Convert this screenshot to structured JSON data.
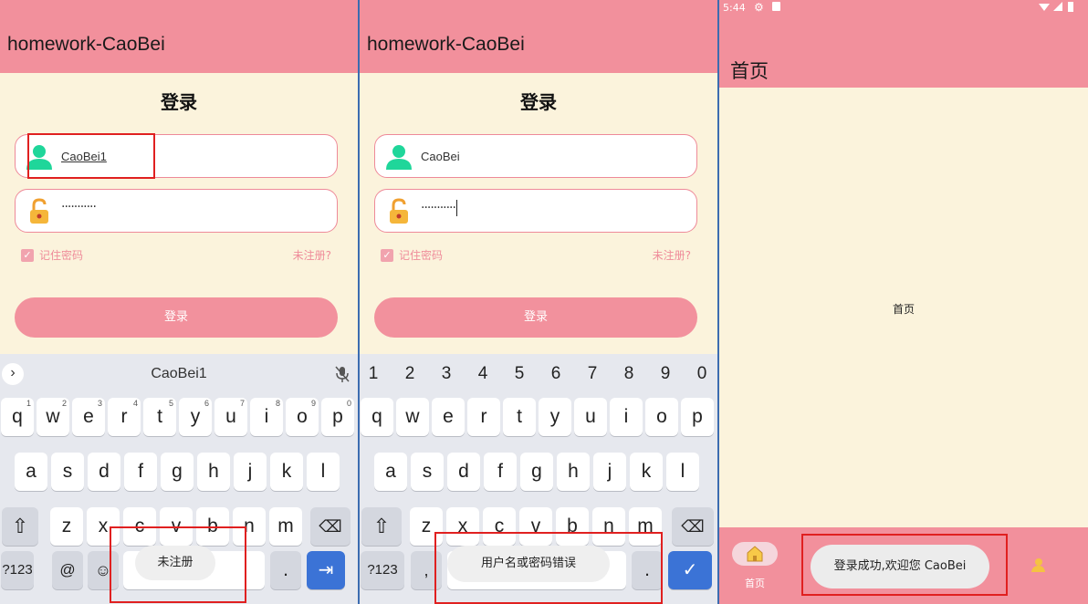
{
  "screen1": {
    "app_title": "homework-CaoBei",
    "login_title": "登录",
    "username_value": "CaoBei1",
    "password_value": "···········",
    "remember_label": "记住密码",
    "register_link": "未注册?",
    "login_button": "登录",
    "suggestion": "CaoBei1",
    "toast": "未注册",
    "keys_row1": [
      "q",
      "w",
      "e",
      "r",
      "t",
      "y",
      "u",
      "i",
      "o",
      "p"
    ],
    "keys_row1_num": [
      "1",
      "2",
      "3",
      "4",
      "5",
      "6",
      "7",
      "8",
      "9",
      "0"
    ],
    "keys_row2": [
      "a",
      "s",
      "d",
      "f",
      "g",
      "h",
      "j",
      "k",
      "l"
    ],
    "keys_row3": [
      "z",
      "x",
      "c",
      "v",
      "b",
      "n",
      "m"
    ],
    "key_symbols": "?123",
    "key_at": "@",
    "key_period": "."
  },
  "screen2": {
    "app_title": "homework-CaoBei",
    "login_title": "登录",
    "username_value": "CaoBei",
    "password_value": "···········",
    "remember_label": "记住密码",
    "register_link": "未注册?",
    "login_button": "登录",
    "number_row": [
      "1",
      "2",
      "3",
      "4",
      "5",
      "6",
      "7",
      "8",
      "9",
      "0"
    ],
    "toast": "用户名或密码错误",
    "keys_row1": [
      "q",
      "w",
      "e",
      "r",
      "t",
      "y",
      "u",
      "i",
      "o",
      "p"
    ],
    "keys_row2": [
      "a",
      "s",
      "d",
      "f",
      "g",
      "h",
      "j",
      "k",
      "l"
    ],
    "keys_row3": [
      "z",
      "x",
      "c",
      "v",
      "b",
      "n",
      "m"
    ],
    "key_symbols": "?123",
    "key_comma": ",",
    "key_period": "."
  },
  "screen3": {
    "status_time": "5:44",
    "app_title": "首页",
    "center_text": "首页",
    "nav_home_label": "首页",
    "toast": "登录成功,欢迎您 CaoBei"
  },
  "colors": {
    "primary": "#f2909c",
    "background": "#fbf3dc",
    "accent_green": "#1fd69a",
    "highlight_box": "#e02020"
  }
}
